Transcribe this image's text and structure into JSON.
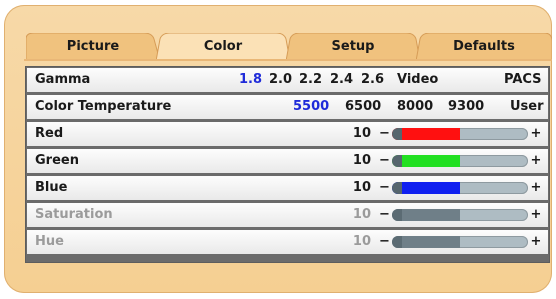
{
  "tabs": [
    {
      "label": "Picture",
      "active": false
    },
    {
      "label": "Color",
      "active": true
    },
    {
      "label": "Setup",
      "active": false
    },
    {
      "label": "Defaults",
      "active": false
    }
  ],
  "gamma": {
    "label": "Gamma",
    "options": [
      "1.8",
      "2.0",
      "2.2",
      "2.4",
      "2.6",
      "Video",
      "PACS"
    ],
    "selected": "1.8"
  },
  "color_temperature": {
    "label": "Color Temperature",
    "options": [
      "5500",
      "6500",
      "8000",
      "9300",
      "User"
    ],
    "selected": "5500"
  },
  "sliders": [
    {
      "label": "Red",
      "value": "10",
      "level": 0.5,
      "color": "#ff1010",
      "enabled": true
    },
    {
      "label": "Green",
      "value": "10",
      "level": 0.5,
      "color": "#22e022",
      "enabled": true
    },
    {
      "label": "Blue",
      "value": "10",
      "level": 0.5,
      "color": "#1020f0",
      "enabled": true
    },
    {
      "label": "Saturation",
      "value": "10",
      "level": 0.5,
      "color": "#6f7f88",
      "enabled": false
    },
    {
      "label": "Hue",
      "value": "10",
      "level": 0.5,
      "color": "#6f7f88",
      "enabled": false
    }
  ],
  "controls": {
    "minus": "−",
    "plus": "+"
  },
  "colors": {
    "panel": "#f5cf92",
    "tab_inactive": "#f0c27e",
    "tab_active": "#fbe1b6",
    "selected_option": "#1f2bd9"
  }
}
